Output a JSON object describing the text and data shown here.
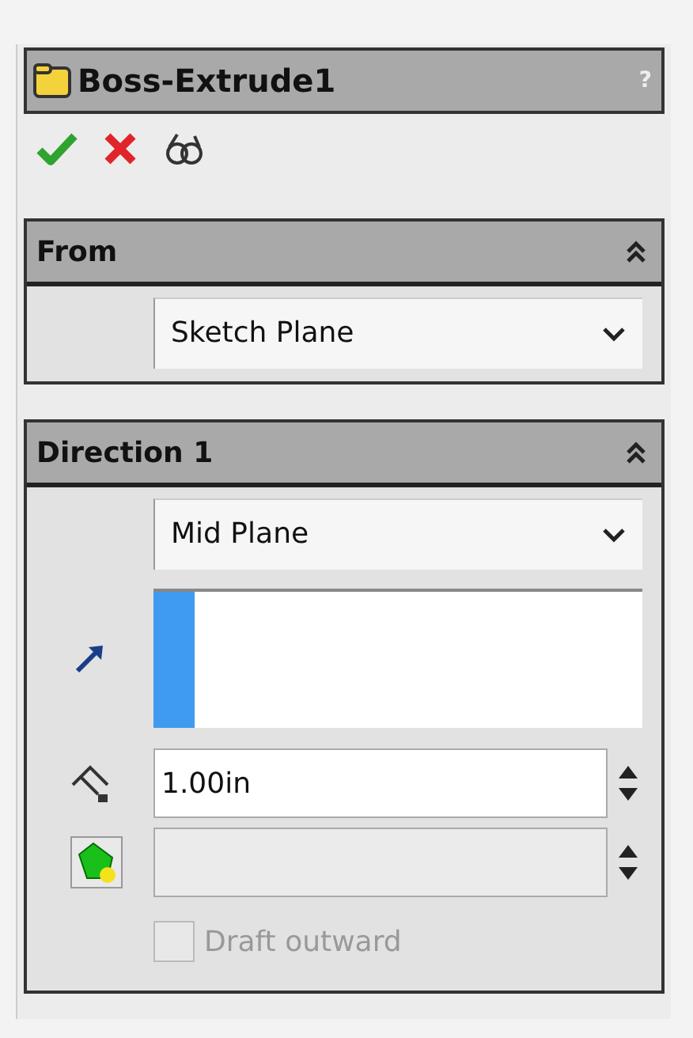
{
  "window": {
    "title": "Boss-Extrude1",
    "help": "?"
  },
  "groups": [
    {
      "title": "From",
      "expanded": true,
      "fields": [
        {
          "kind": "dropdown",
          "value": "Sketch Plane"
        }
      ]
    },
    {
      "title": "Direction 1",
      "expanded": true,
      "fields": [
        {
          "kind": "dropdown",
          "value": "Mid Plane"
        },
        {
          "kind": "selection",
          "selected": true
        },
        {
          "kind": "depth",
          "value": "1.00in",
          "disabled": false
        },
        {
          "kind": "draft",
          "disabled": true
        },
        {
          "kind": "checkbox",
          "label": "Draft outward",
          "checked": false,
          "disabled": true
        }
      ]
    }
  ]
}
